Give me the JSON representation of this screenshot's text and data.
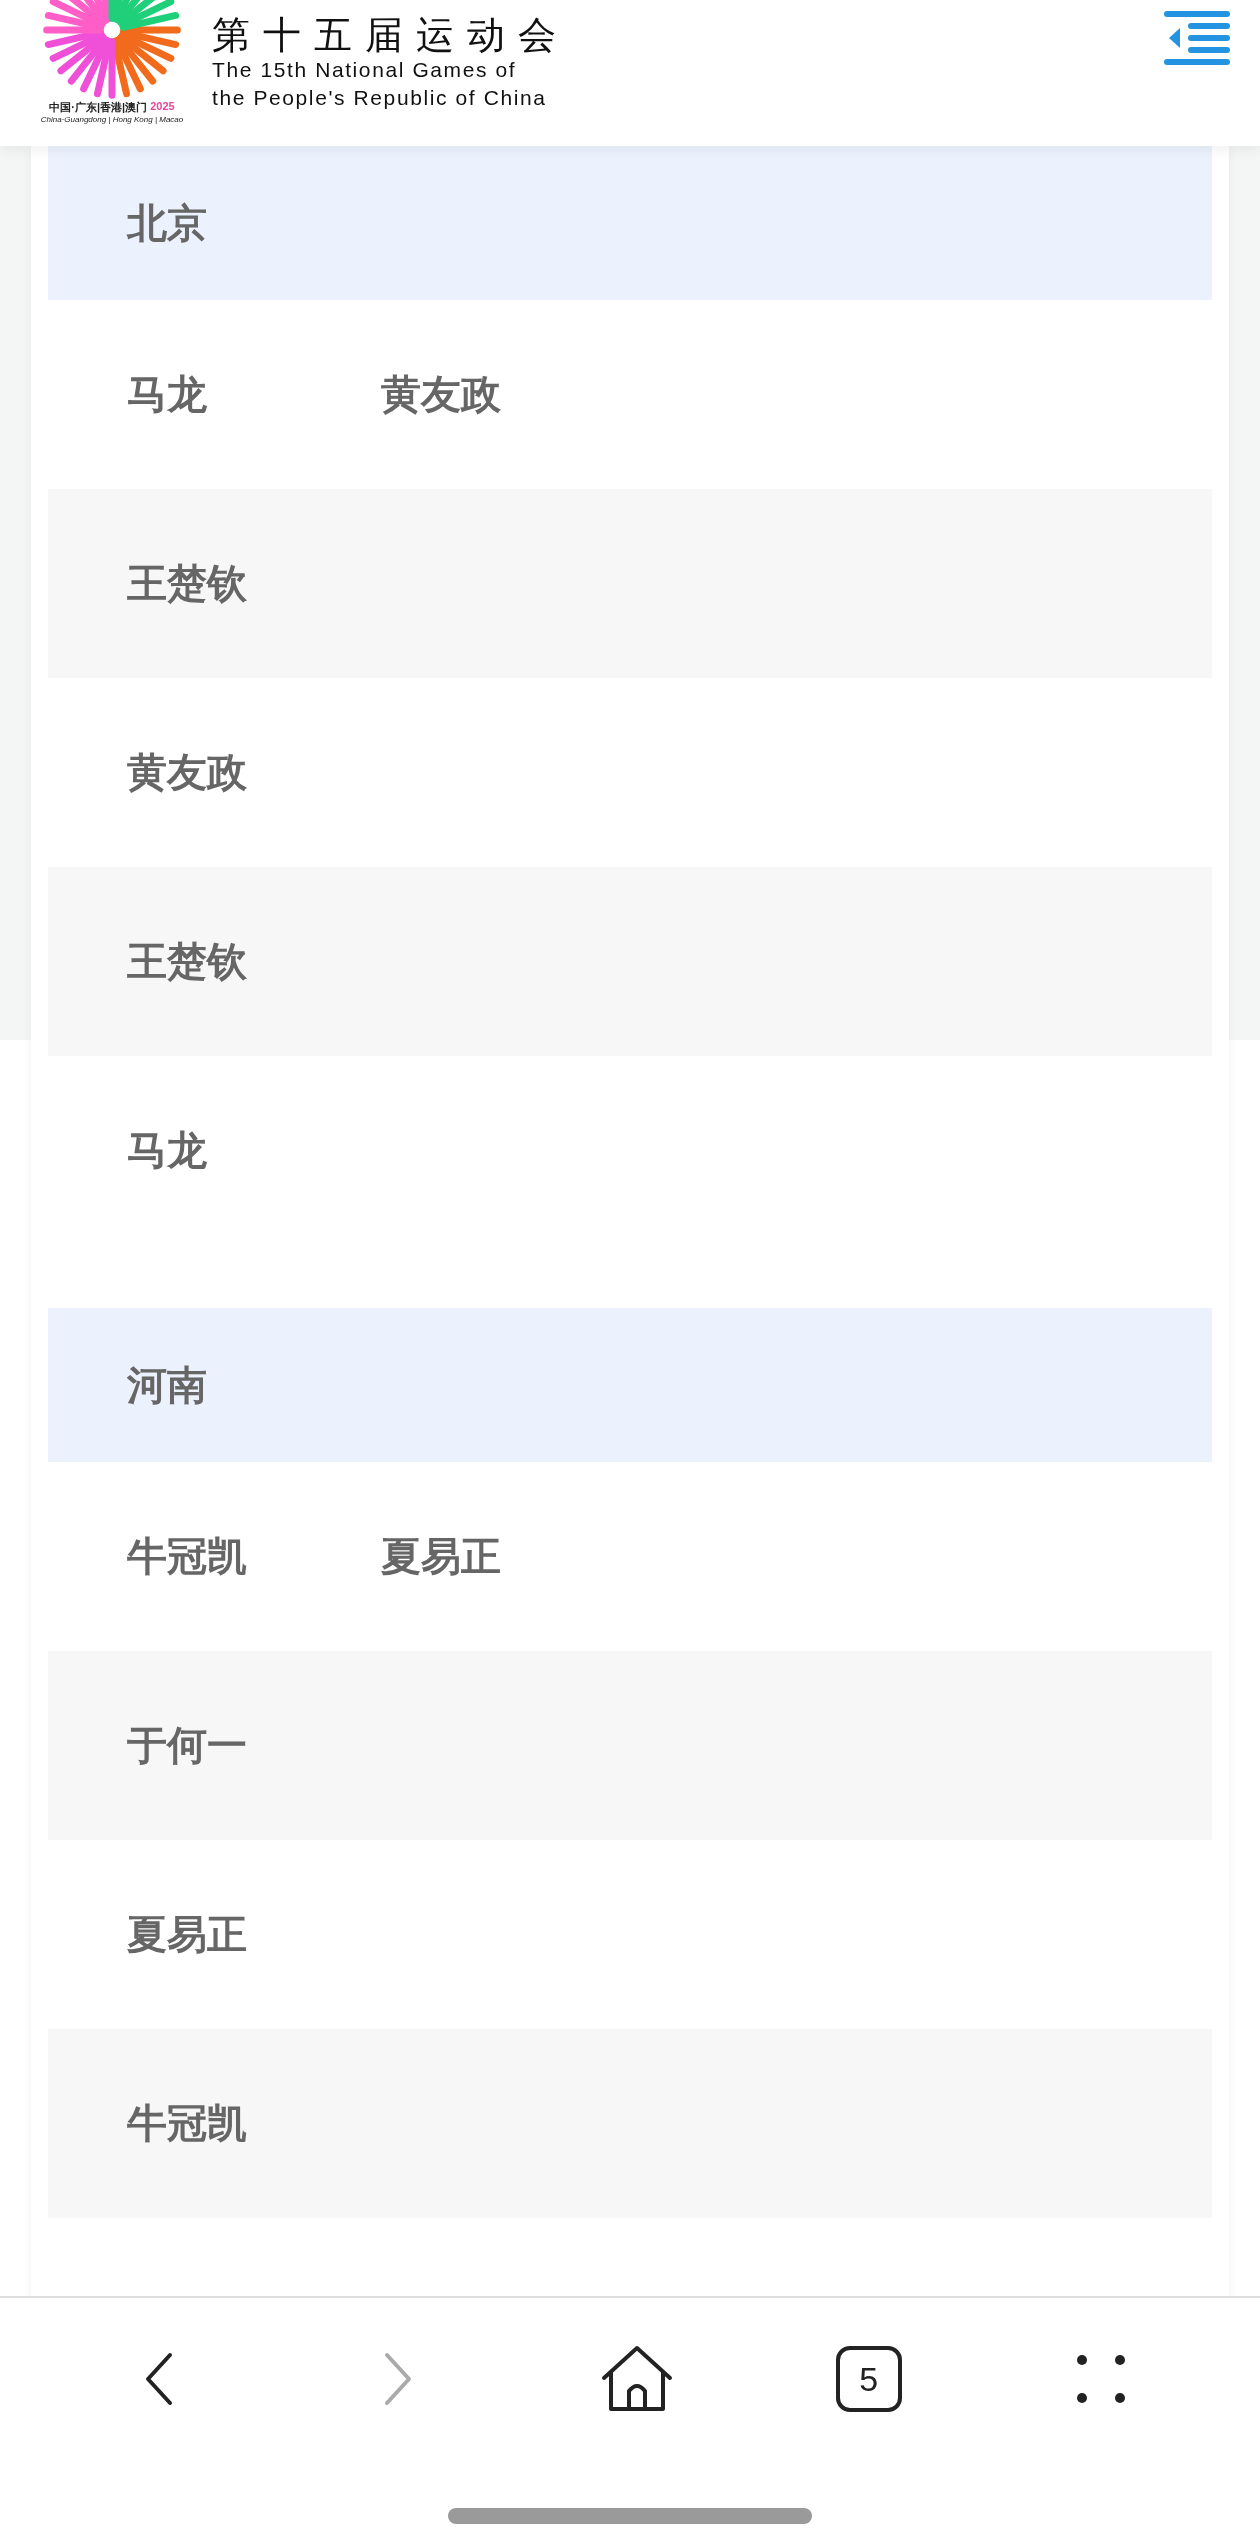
{
  "header": {
    "title_cn": "第十五届运动会",
    "title_en_1": "The 15th National Games of",
    "title_en_2": "the People's Republic of China",
    "logo_cn": "中国·广东|香港|澳门",
    "logo_year": "2025",
    "logo_en": "China·Guangdong | Hong Kong | Macao"
  },
  "groups": [
    {
      "region": "北京",
      "rows": [
        [
          "马龙",
          "黄友政"
        ],
        [
          "王楚钦"
        ],
        [
          "黄友政"
        ],
        [
          "王楚钦"
        ],
        [
          "马龙"
        ]
      ]
    },
    {
      "region": "河南",
      "rows": [
        [
          "牛冠凯",
          "夏易正"
        ],
        [
          "于何一"
        ],
        [
          "夏易正"
        ],
        [
          "牛冠凯"
        ]
      ]
    }
  ],
  "browser_nav": {
    "tab_count": "5",
    "forward_disabled": true
  }
}
